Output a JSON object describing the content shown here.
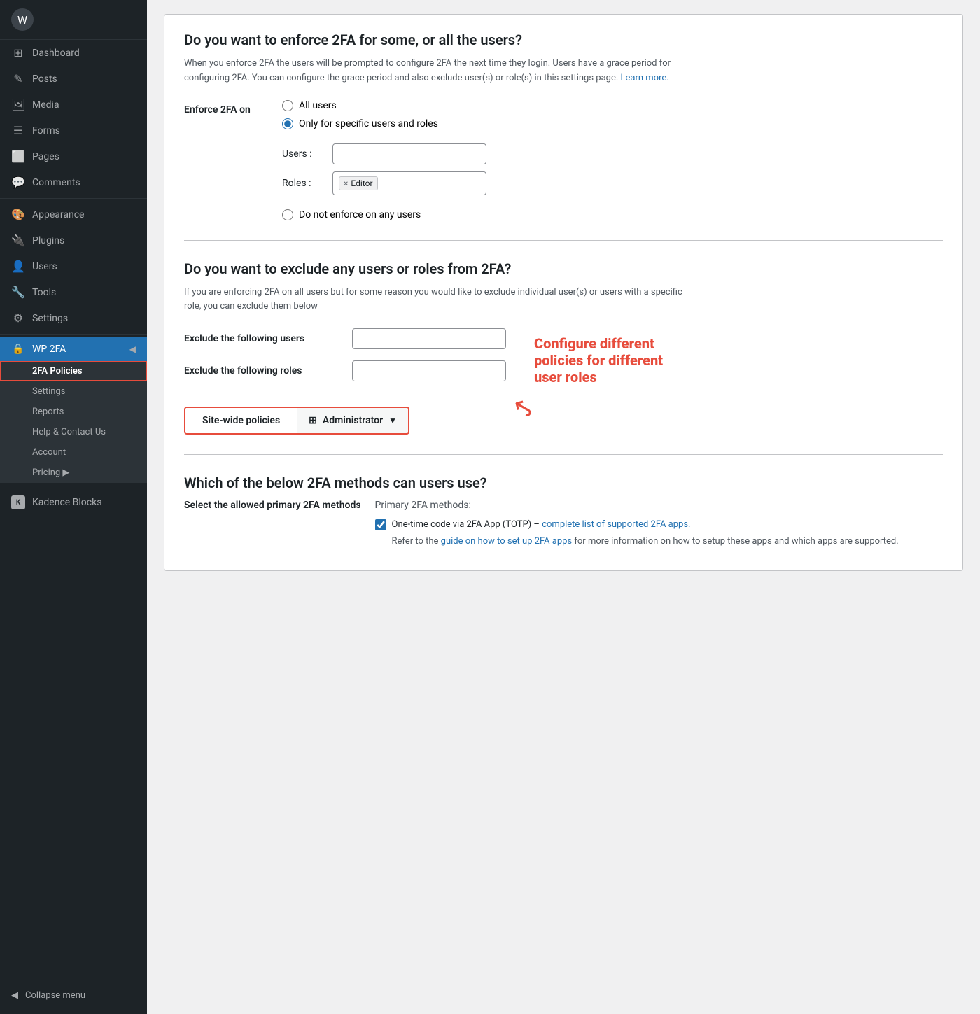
{
  "sidebar": {
    "logo_icon": "W",
    "nav_items": [
      {
        "id": "dashboard",
        "label": "Dashboard",
        "icon": "⊞"
      },
      {
        "id": "posts",
        "label": "Posts",
        "icon": "✎"
      },
      {
        "id": "media",
        "label": "Media",
        "icon": "⊟"
      },
      {
        "id": "forms",
        "label": "Forms",
        "icon": "☰"
      },
      {
        "id": "pages",
        "label": "Pages",
        "icon": "⬜"
      },
      {
        "id": "comments",
        "label": "Comments",
        "icon": "💬"
      },
      {
        "id": "appearance",
        "label": "Appearance",
        "icon": "🎨"
      },
      {
        "id": "plugins",
        "label": "Plugins",
        "icon": "🔌"
      },
      {
        "id": "users",
        "label": "Users",
        "icon": "👤"
      },
      {
        "id": "tools",
        "label": "Tools",
        "icon": "🔧"
      },
      {
        "id": "settings",
        "label": "Settings",
        "icon": "⚙"
      }
    ],
    "wp2fa": {
      "label": "WP 2FA",
      "icon": "🔒",
      "submenu": [
        {
          "id": "2fa-policies",
          "label": "2FA Policies",
          "active": true
        },
        {
          "id": "settings",
          "label": "Settings"
        },
        {
          "id": "reports",
          "label": "Reports"
        },
        {
          "id": "help",
          "label": "Help & Contact Us"
        },
        {
          "id": "account",
          "label": "Account"
        },
        {
          "id": "pricing",
          "label": "Pricing ▶"
        }
      ]
    },
    "kadence": {
      "label": "Kadence Blocks",
      "icon": "K"
    },
    "collapse": {
      "label": "Collapse menu",
      "icon": "◀"
    }
  },
  "main": {
    "section1": {
      "title": "Do you want to enforce 2FA for some, or all the users?",
      "description": "When you enforce 2FA the users will be prompted to configure 2FA the next time they login. Users have a grace period for configuring 2FA. You can configure the grace period and also exclude user(s) or role(s) in this settings page.",
      "learn_more_label": "Learn more.",
      "enforce_label": "Enforce 2FA on",
      "radio_options": [
        {
          "id": "all-users",
          "label": "All users",
          "checked": false
        },
        {
          "id": "specific",
          "label": "Only for specific users and roles",
          "checked": true
        },
        {
          "id": "none",
          "label": "Do not enforce on any users",
          "checked": false
        }
      ],
      "users_label": "Users :",
      "users_value": "",
      "roles_label": "Roles :",
      "roles_tag": "Editor"
    },
    "section2": {
      "title": "Do you want to exclude any users or roles from 2FA?",
      "description": "If you are enforcing 2FA on all users but for some reason you would like to exclude individual user(s) or users with a specific role, you can exclude them below",
      "exclude_users_label": "Exclude the following users",
      "exclude_roles_label": "Exclude the following roles",
      "annotation": {
        "text": "Configure different policies for different user roles",
        "arrow": "↙"
      }
    },
    "tabs": {
      "site_wide_label": "Site-wide policies",
      "administrator_label": "Administrator",
      "dropdown_icon": "▼"
    },
    "section3": {
      "title": "Which of the below 2FA methods can users use?",
      "select_label": "Select the allowed primary 2FA methods",
      "primary_methods_header": "Primary 2FA methods:",
      "checkbox_totp_label": "One-time code via 2FA App (TOTP) –",
      "checkbox_totp_link": "complete list of supported 2FA apps.",
      "checkbox_totp_checked": true,
      "sublabel": "Refer to the",
      "sublabel_link": "guide on how to set up 2FA apps",
      "sublabel_rest": "for more information on how to setup these apps and which apps are supported."
    }
  }
}
